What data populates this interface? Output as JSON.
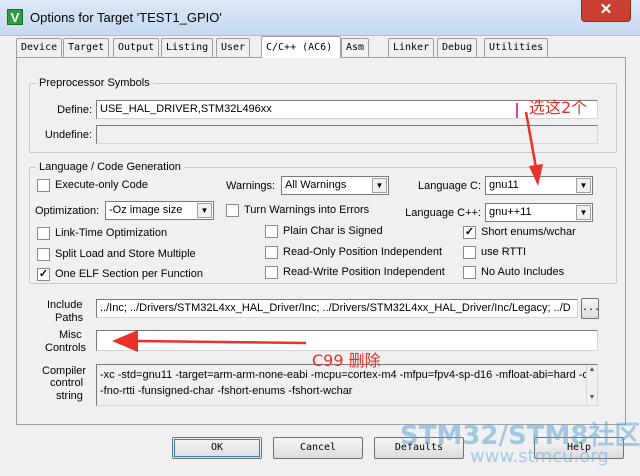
{
  "window": {
    "title": "Options for Target 'TEST1_GPIO'",
    "icon": "V",
    "close": "✕"
  },
  "tabs": [
    {
      "label": "Device",
      "active": false
    },
    {
      "label": "Target",
      "active": false
    },
    {
      "label": "Output",
      "active": false
    },
    {
      "label": "Listing",
      "active": false
    },
    {
      "label": "User",
      "active": false
    },
    {
      "label": "C/C++ (AC6)",
      "active": true
    },
    {
      "label": "Asm",
      "active": false
    },
    {
      "label": "Linker",
      "active": false
    },
    {
      "label": "Debug",
      "active": false
    },
    {
      "label": "Utilities",
      "active": false
    }
  ],
  "preprocessor": {
    "title": "Preprocessor Symbols",
    "define_label": "Define:",
    "define_value": "USE_HAL_DRIVER,STM32L496xx",
    "undefine_label": "Undefine:",
    "undefine_value": ""
  },
  "language": {
    "title": "Language / Code Generation",
    "execute_only": {
      "label": "Execute-only Code",
      "checked": false
    },
    "optimization_label": "Optimization:",
    "optimization_value": "-Oz image size",
    "link_time": {
      "label": "Link-Time Optimization",
      "checked": false
    },
    "split_load": {
      "label": "Split Load and Store Multiple",
      "checked": false
    },
    "one_elf": {
      "label": "One ELF Section per Function",
      "checked": true
    },
    "warnings_label": "Warnings:",
    "warnings_value": "All Warnings",
    "turn_warnings": {
      "label": "Turn Warnings into Errors",
      "checked": false
    },
    "plain_char": {
      "label": "Plain Char is Signed",
      "checked": false
    },
    "ropi": {
      "label": "Read-Only Position Independent",
      "checked": false
    },
    "rwpi": {
      "label": "Read-Write Position Independent",
      "checked": false
    },
    "language_c_label": "Language C:",
    "language_c_value": "gnu11",
    "language_cpp_label": "Language C++:",
    "language_cpp_value": "gnu++11",
    "short_enums": {
      "label": "Short enums/wchar",
      "checked": true
    },
    "use_rtti": {
      "label": "use RTTI",
      "checked": false
    },
    "no_auto_includes": {
      "label": "No Auto Includes",
      "checked": false
    }
  },
  "paths": {
    "include_label_1": "Include",
    "include_label_2": "Paths",
    "include_value": "../Inc; ../Drivers/STM32L4xx_HAL_Driver/Inc; ../Drivers/STM32L4xx_HAL_Driver/Inc/Legacy; ../D",
    "browse_label": "...",
    "misc_label_1": "Misc",
    "misc_label_2": "Controls",
    "misc_value": "",
    "compiler_label_1": "Compiler",
    "compiler_label_2": "control",
    "compiler_label_3": "string",
    "compiler_line_1": "-xc -std=gnu11 -target=arm-arm-none-eabi -mcpu=cortex-m4 -mfpu=fpv4-sp-d16 -mfloat-abi=hard -c",
    "compiler_line_2": "-fno-rtti -funsigned-char -fshort-enums -fshort-wchar"
  },
  "buttons": {
    "ok": "OK",
    "cancel": "Cancel",
    "defaults": "Defaults",
    "help": "Help"
  },
  "annotations": {
    "select": "选这2个",
    "delete": "C99 删除"
  },
  "watermark": {
    "brand": "STM32/STM8社区",
    "url": "www.stmcu.org"
  },
  "colors": {
    "annotation": "#e8322a",
    "watermark": "#5fa8d8"
  }
}
